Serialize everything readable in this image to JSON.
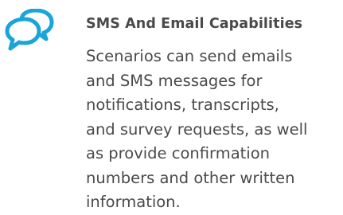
{
  "feature": {
    "icon": "speech-bubbles-icon",
    "icon_color": "#1aa5d8",
    "text_color": "#4a4a4a",
    "title": "SMS And Email Capabilities",
    "description_lines": [
      "Scenarios can send emails",
      "and SMS messages for",
      "notifications, transcripts,",
      "and survey requests, as well",
      "as provide confirmation",
      "numbers and other written",
      "information."
    ]
  }
}
